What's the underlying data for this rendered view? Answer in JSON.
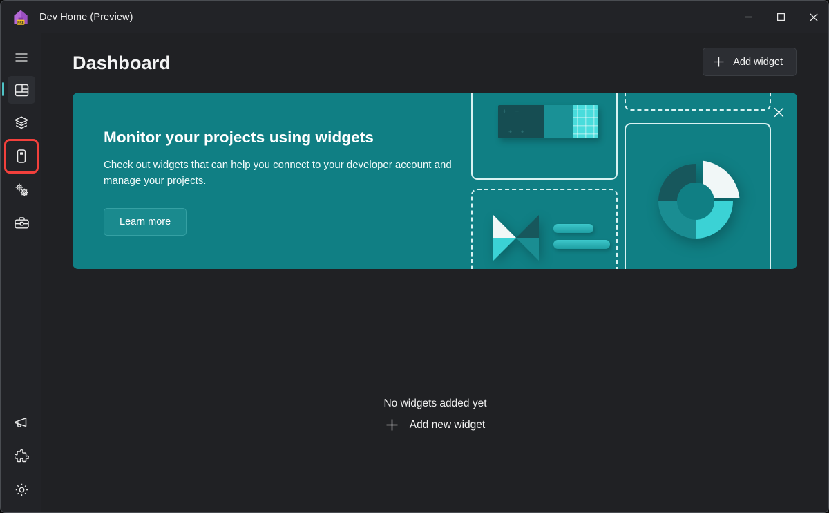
{
  "window": {
    "title": "Dev Home (Preview)",
    "logo_icon": "dev-home-logo-icon",
    "logo_badge": "PRE",
    "controls": [
      {
        "name": "minimize-button",
        "icon": "minimize-icon",
        "label": "Minimize"
      },
      {
        "name": "maximize-button",
        "icon": "maximize-icon",
        "label": "Maximize"
      },
      {
        "name": "close-button",
        "icon": "close-icon",
        "label": "Close"
      }
    ]
  },
  "sidebar": {
    "menu_toggle": {
      "icon": "hamburger-icon",
      "label": "Navigation menu"
    },
    "top_items": [
      {
        "name": "sidebar-item-dashboard",
        "icon": "dashboard-icon",
        "label": "Dashboard",
        "selected": true,
        "highlighted": false
      },
      {
        "name": "sidebar-item-machine-configuration",
        "icon": "layers-icon",
        "label": "Machine configuration",
        "selected": false,
        "highlighted": false
      },
      {
        "name": "sidebar-item-environments",
        "icon": "environments-icon",
        "label": "Environments",
        "selected": false,
        "highlighted": true
      },
      {
        "name": "sidebar-item-utilities",
        "icon": "gears-icon",
        "label": "Utilities",
        "selected": false,
        "highlighted": false
      },
      {
        "name": "sidebar-item-toolbox",
        "icon": "toolbox-icon",
        "label": "Toolbox",
        "selected": false,
        "highlighted": false
      }
    ],
    "bottom_items": [
      {
        "name": "sidebar-item-feedback",
        "icon": "megaphone-icon",
        "label": "Send feedback",
        "selected": false,
        "highlighted": false
      },
      {
        "name": "sidebar-item-extensions",
        "icon": "puzzle-piece-icon",
        "label": "Extensions",
        "selected": false,
        "highlighted": false
      },
      {
        "name": "sidebar-item-settings",
        "icon": "gear-icon",
        "label": "Settings",
        "selected": false,
        "highlighted": false
      }
    ],
    "selection_indicator_color": "#4fc3c6",
    "highlight_color": "#f2403c"
  },
  "page": {
    "title": "Dashboard",
    "add_widget_button": {
      "label": "Add widget",
      "icon": "plus-icon"
    }
  },
  "banner": {
    "heading": "Monitor your projects using widgets",
    "body": "Check out widgets that can help you connect to your developer account and manage your projects.",
    "learn_more_label": "Learn more",
    "close_icon": "close-icon",
    "background_color": "#107f84",
    "illustration": {
      "name": "widgets-illustration",
      "bar_segments": [
        {
          "name": "bar-segment-dark",
          "color": "#164d52"
        },
        {
          "name": "bar-segment-mid",
          "color": "#1a9196"
        },
        {
          "name": "bar-segment-bright",
          "color": "#49dcdc"
        }
      ],
      "donut_segments": [
        {
          "name": "donut-segment-light",
          "color": "#f1f7f7"
        },
        {
          "name": "donut-segment-bright",
          "color": "#3bd2d5"
        },
        {
          "name": "donut-segment-mid",
          "color": "#1a8d92"
        },
        {
          "name": "donut-segment-dark",
          "color": "#17575c"
        }
      ],
      "placeholder_boxes": [
        {
          "name": "widget-placeholder-bar",
          "style": "solid"
        },
        {
          "name": "widget-placeholder-diamond",
          "style": "dashed"
        },
        {
          "name": "widget-placeholder-top",
          "style": "dashed"
        },
        {
          "name": "widget-placeholder-donut",
          "style": "solid"
        }
      ]
    }
  },
  "empty_state": {
    "message": "No widgets added yet",
    "add_label": "Add new widget",
    "add_icon": "plus-icon"
  }
}
